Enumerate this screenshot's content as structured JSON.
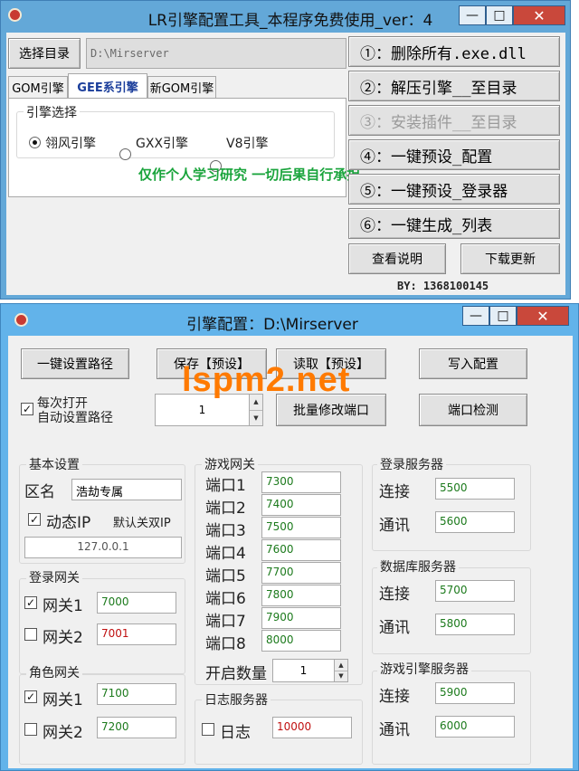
{
  "window1": {
    "title": "LR引擎配置工具_本程序免费使用_ver：4",
    "controls": {
      "minimize": "—",
      "maximize": "□",
      "close": "✕"
    },
    "choose_dir_label": "选择目录",
    "dir_value": "D:\\Mirserver",
    "tabs": [
      "GOM引擎",
      "GEE系引擎",
      "新GOM引擎"
    ],
    "engine_group_title": "引擎选择",
    "radios": [
      "翎风引擎",
      "GXX引擎",
      "V8引擎"
    ],
    "selected_radio": "翎风引擎",
    "notice": "仅作个人学习研究 一切后果自行承担",
    "actions": [
      {
        "label": "①：删除所有.exe.dll",
        "enabled": true
      },
      {
        "label": "②：解压引擎__至目录",
        "enabled": true
      },
      {
        "label": "③：安装插件__至目录",
        "enabled": false
      },
      {
        "label": "④：一键预设_配置",
        "enabled": true
      },
      {
        "label": "⑤：一键预设_登录器",
        "enabled": true
      },
      {
        "label": "⑥：一键生成_列表",
        "enabled": true
      }
    ],
    "view_help_label": "查看说明",
    "download_update_label": "下载更新",
    "by_text": "BY: 1368100145"
  },
  "window2": {
    "title": "引擎配置：D:\\Mirserver",
    "controls": {
      "minimize": "—",
      "maximize": "□",
      "close": "✕"
    },
    "watermark": "lspm2.net",
    "buttons": {
      "set_path": "一键设置路径",
      "save_preset": "保存【预设】",
      "read_preset": "读取【预设】",
      "write_config": "写入配置",
      "batch_ports": "批量修改端口",
      "port_check": "端口检测"
    },
    "auto_path": {
      "line1": "每次打开",
      "line2": "自动设置路径",
      "checked": true
    },
    "count_value": "1",
    "basic": {
      "title": "基本设置",
      "zone_label": "区名",
      "zone_value": "浩劫专属",
      "dynamic_ip_label": "动态IP",
      "dynamic_ip_checked": true,
      "default_dual_ip": "默认关双IP",
      "ip_value": "127.0.0.1"
    },
    "login_gateway": {
      "title": "登录网关",
      "items": [
        {
          "label": "网关1",
          "value": "7000",
          "checked": true
        },
        {
          "label": "网关2",
          "value": "7001",
          "checked": false
        }
      ]
    },
    "role_gateway": {
      "title": "角色网关",
      "items": [
        {
          "label": "网关1",
          "value": "7100",
          "checked": true
        },
        {
          "label": "网关2",
          "value": "7200",
          "checked": false
        }
      ]
    },
    "game_gateway": {
      "title": "游戏网关",
      "ports": [
        {
          "label": "端口1",
          "value": "7300"
        },
        {
          "label": "端口2",
          "value": "7400"
        },
        {
          "label": "端口3",
          "value": "7500"
        },
        {
          "label": "端口4",
          "value": "7600"
        },
        {
          "label": "端口5",
          "value": "7700"
        },
        {
          "label": "端口6",
          "value": "7800"
        },
        {
          "label": "端口7",
          "value": "7900"
        },
        {
          "label": "端口8",
          "value": "8000"
        }
      ],
      "open_count_label": "开启数量",
      "open_count_value": "1"
    },
    "log_server": {
      "title": "日志服务器",
      "label": "日志",
      "value": "10000",
      "checked": false
    },
    "login_server": {
      "title": "登录服务器",
      "connect_label": "连接",
      "connect_value": "5500",
      "comm_label": "通讯",
      "comm_value": "5600"
    },
    "db_server": {
      "title": "数据库服务器",
      "connect_label": "连接",
      "connect_value": "5700",
      "comm_label": "通讯",
      "comm_value": "5800"
    },
    "engine_server": {
      "title": "游戏引擎服务器",
      "connect_label": "连接",
      "connect_value": "5900",
      "comm_label": "通讯",
      "comm_value": "6000"
    }
  }
}
